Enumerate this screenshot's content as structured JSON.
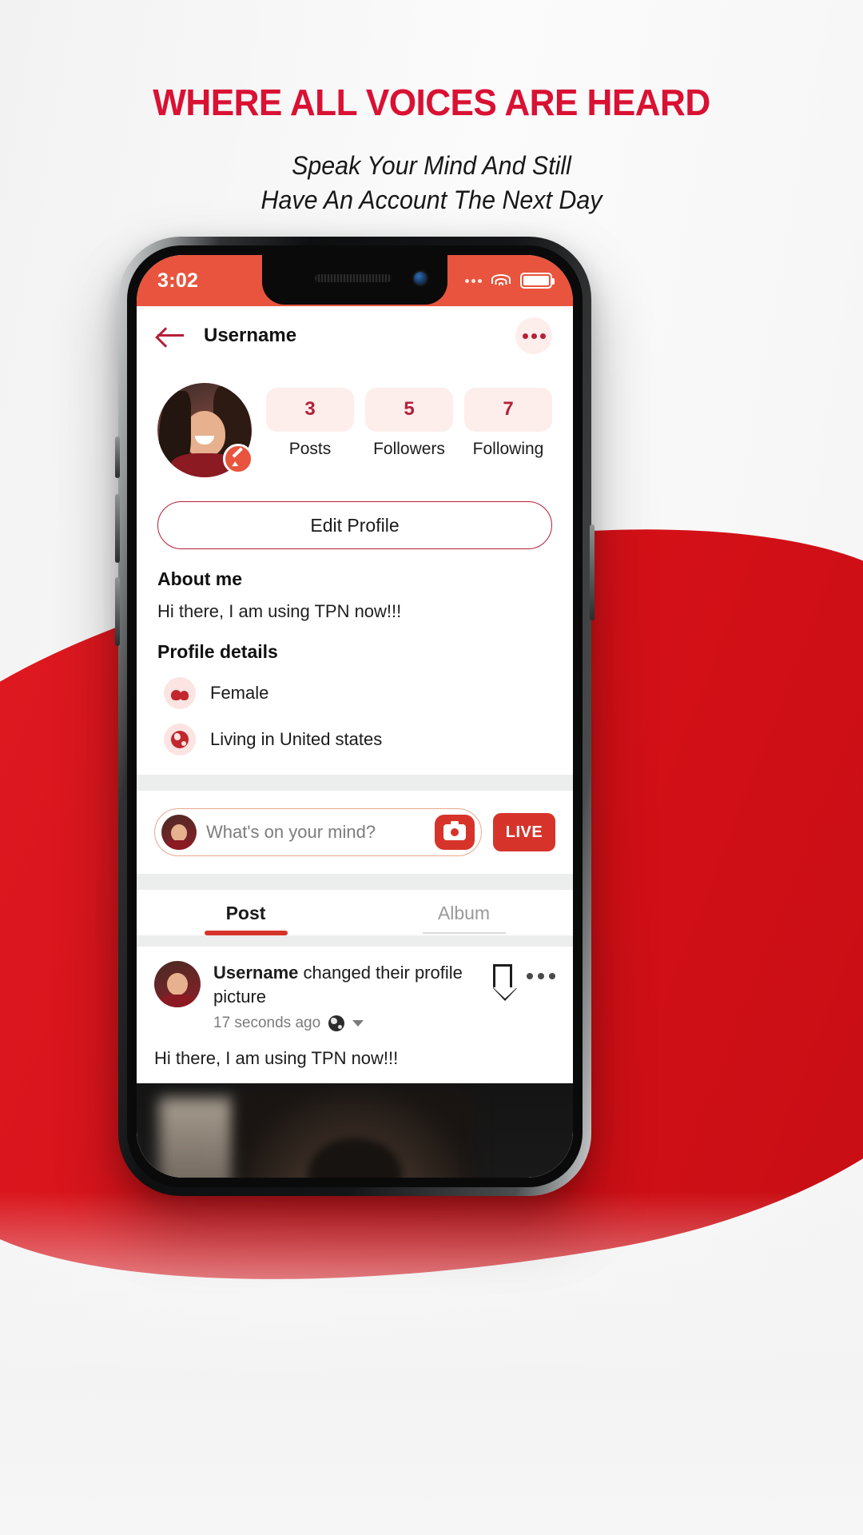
{
  "promo": {
    "headline": "WHERE ALL VOICES ARE HEARD",
    "subline_1": "Speak Your Mind And Still",
    "subline_2": "Have An Account The Next Day",
    "headline_color": "#d91133"
  },
  "status_bar": {
    "time": "3:02",
    "wifi_icon": "wifi-icon",
    "battery_icon": "battery-full-icon",
    "signal_icon": "signal-dots-icon",
    "background_color": "#e8543d"
  },
  "app_nav": {
    "back_icon": "arrow-left-icon",
    "title": "Username",
    "more_icon": "more-horizontal-icon"
  },
  "profile": {
    "avatar_name": "profile-avatar",
    "edit_badge_icon": "pencil-icon",
    "stats": [
      {
        "value": "3",
        "label": "Posts"
      },
      {
        "value": "5",
        "label": "Followers"
      },
      {
        "value": "7",
        "label": "Following"
      }
    ],
    "edit_profile_label": "Edit Profile",
    "about_title": "About me",
    "about_text": "Hi there, I am using TPN now!!!",
    "details_title": "Profile details",
    "details": [
      {
        "icon": "people-icon",
        "text": "Female"
      },
      {
        "icon": "globe-icon",
        "text": "Living in United states"
      }
    ],
    "accent_color": "#b61f38",
    "pill_background": "#fdeeec"
  },
  "composer": {
    "avatar_name": "composer-avatar",
    "placeholder": "What's on your mind?",
    "camera_icon": "camera-icon",
    "live_label": "LIVE",
    "live_color": "#d6342a"
  },
  "tabs": [
    {
      "label": "Post",
      "active": true
    },
    {
      "label": "Album",
      "active": false
    }
  ],
  "feed_post": {
    "author": "Username",
    "action": "changed their profile picture",
    "timestamp": "17 seconds ago",
    "privacy_icon": "globe-icon",
    "privacy_caret_icon": "chevron-down-icon",
    "bookmark_icon": "bookmark-icon",
    "more_icon": "more-horizontal-icon",
    "body_text": "Hi there, I am using TPN now!!!",
    "image_name": "post-photo"
  }
}
